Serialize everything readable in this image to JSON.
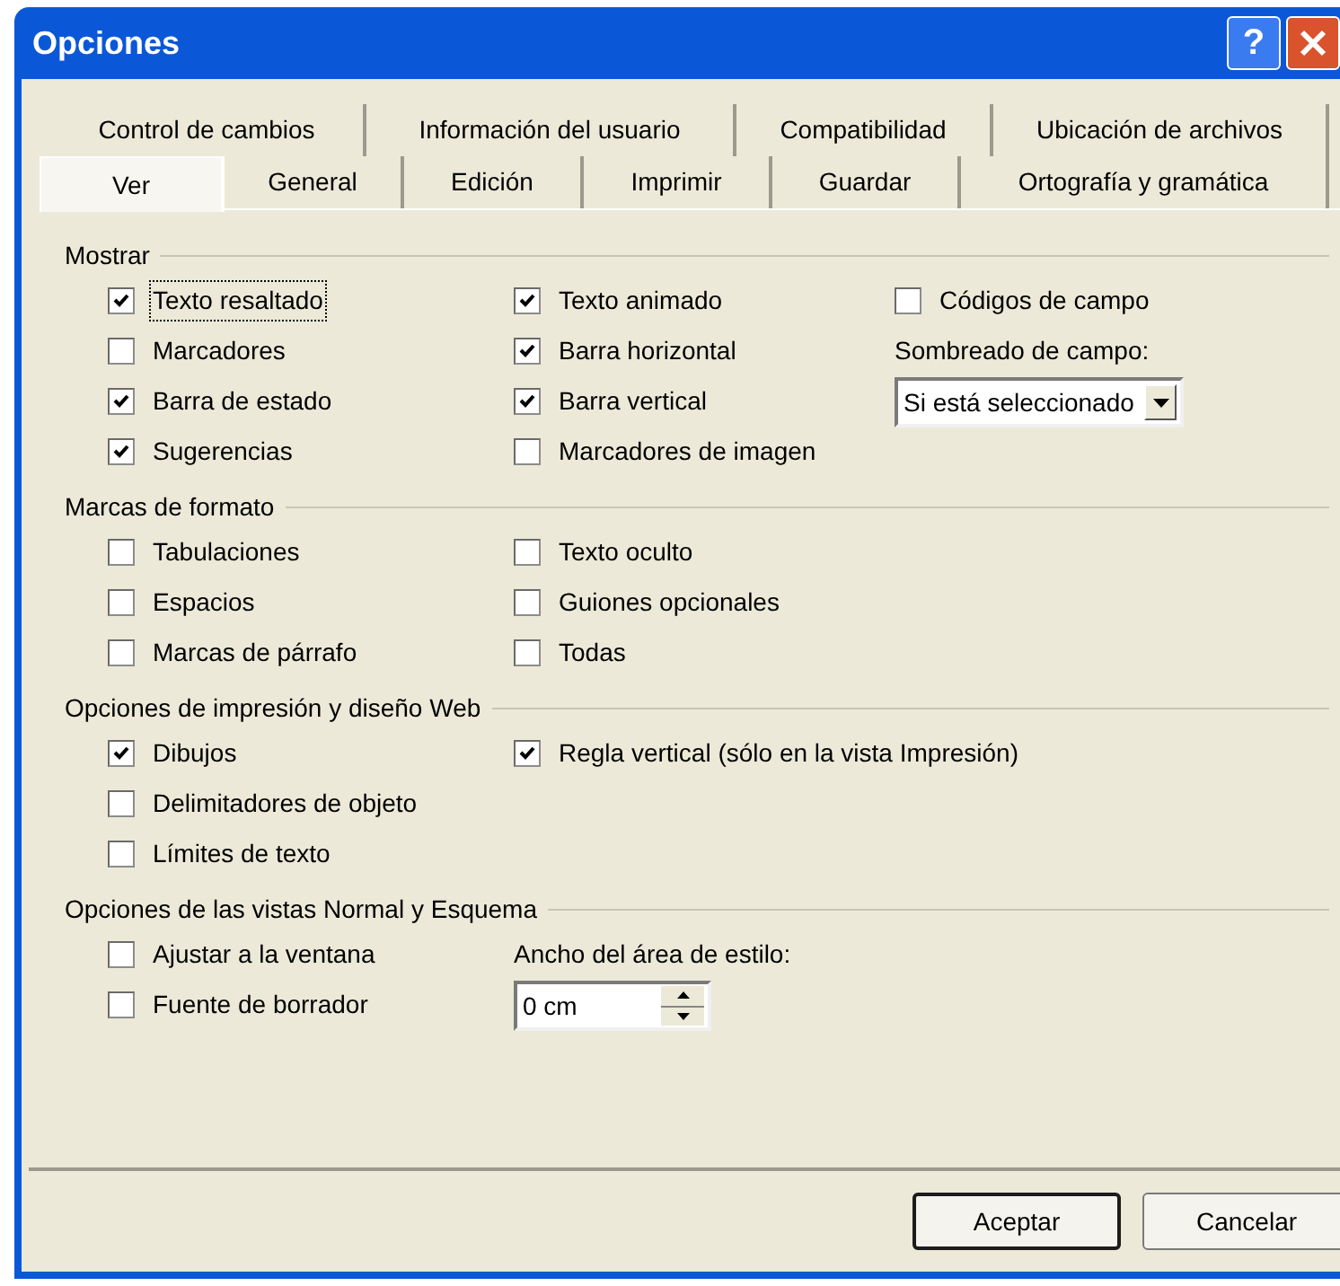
{
  "window": {
    "title": "Opciones",
    "help_label": "?"
  },
  "tab_rows": [
    [
      {
        "label": "Control de cambios",
        "selected": false
      },
      {
        "label": "Información del usuario",
        "selected": false
      },
      {
        "label": "Compatibilidad",
        "selected": false
      },
      {
        "label": "Ubicación de archivos",
        "selected": false
      }
    ],
    [
      {
        "label": "Ver",
        "selected": true
      },
      {
        "label": "General",
        "selected": false
      },
      {
        "label": "Edición",
        "selected": false
      },
      {
        "label": "Imprimir",
        "selected": false
      },
      {
        "label": "Guardar",
        "selected": false
      },
      {
        "label": "Ortografía y gramática",
        "selected": false
      }
    ]
  ],
  "sections": [
    {
      "title": "Mostrar",
      "columns": [
        [
          {
            "kind": "checkbox",
            "label": "Texto resaltado",
            "checked": true,
            "focused": true
          },
          {
            "kind": "checkbox",
            "label": "Marcadores",
            "checked": false,
            "focused": false
          },
          {
            "kind": "checkbox",
            "label": "Barra de estado",
            "checked": true,
            "focused": false
          },
          {
            "kind": "checkbox",
            "label": "Sugerencias",
            "checked": true,
            "focused": false
          }
        ],
        [
          {
            "kind": "checkbox",
            "label": "Texto animado",
            "checked": true,
            "focused": false
          },
          {
            "kind": "checkbox",
            "label": "Barra horizontal",
            "checked": true,
            "focused": false
          },
          {
            "kind": "checkbox",
            "label": "Barra vertical",
            "checked": true,
            "focused": false
          },
          {
            "kind": "checkbox",
            "label": "Marcadores de imagen",
            "checked": false,
            "focused": false
          }
        ],
        [
          {
            "kind": "checkbox",
            "label": "Códigos de campo",
            "checked": false,
            "focused": false
          },
          {
            "kind": "label",
            "label": "Sombreado de campo:"
          },
          {
            "kind": "dropdown",
            "value": "Si está seleccionado"
          }
        ]
      ]
    },
    {
      "title": "Marcas de formato",
      "columns": [
        [
          {
            "kind": "checkbox",
            "label": "Tabulaciones",
            "checked": false,
            "focused": false
          },
          {
            "kind": "checkbox",
            "label": "Espacios",
            "checked": false,
            "focused": false
          },
          {
            "kind": "checkbox",
            "label": "Marcas de párrafo",
            "checked": false,
            "focused": false
          }
        ],
        [
          {
            "kind": "checkbox",
            "label": "Texto oculto",
            "checked": false,
            "focused": false
          },
          {
            "kind": "checkbox",
            "label": "Guiones opcionales",
            "checked": false,
            "focused": false
          },
          {
            "kind": "checkbox",
            "label": "Todas",
            "checked": false,
            "focused": false
          }
        ]
      ]
    },
    {
      "title": "Opciones de impresión y diseño Web",
      "columns": [
        [
          {
            "kind": "checkbox",
            "label": "Dibujos",
            "checked": true,
            "focused": false
          },
          {
            "kind": "checkbox",
            "label": "Delimitadores de objeto",
            "checked": false,
            "focused": false
          },
          {
            "kind": "checkbox",
            "label": "Límites de texto",
            "checked": false,
            "focused": false
          }
        ],
        [
          {
            "kind": "checkbox",
            "label": "Regla vertical (sólo en la vista Impresión)",
            "checked": true,
            "focused": false
          }
        ]
      ]
    },
    {
      "title": "Opciones de las vistas Normal y Esquema",
      "columns": [
        [
          {
            "kind": "checkbox",
            "label": "Ajustar a la ventana",
            "checked": false,
            "focused": false
          },
          {
            "kind": "checkbox",
            "label": "Fuente de borrador",
            "checked": false,
            "focused": false
          }
        ],
        [
          {
            "kind": "label",
            "label": "Ancho del área de estilo:"
          },
          {
            "kind": "spinner",
            "value": "0 cm"
          }
        ]
      ]
    }
  ],
  "buttons": [
    {
      "label": "Aceptar",
      "default": true
    },
    {
      "label": "Cancelar",
      "default": false
    }
  ]
}
